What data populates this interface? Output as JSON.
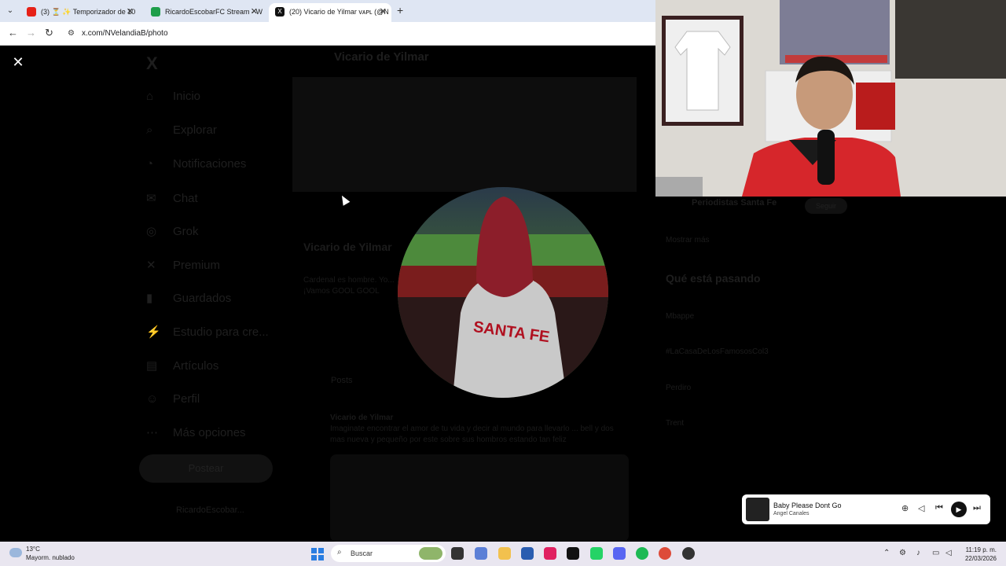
{
  "browser": {
    "tabs": [
      {
        "label": "(3) ⏳ ✨ Temporizador de 10",
        "favicon_color": "#e62117"
      },
      {
        "label": "RicardoEscobarFC Stream - Wa",
        "favicon_color": "#1e9e4a"
      },
      {
        "label": "(20) Vicario de Yilmar vᴀᴘʟ (@N",
        "favicon_color": "#111111"
      }
    ],
    "url": "x.com/NVelandiaB/photo"
  },
  "x_page": {
    "nav": [
      "Inicio",
      "Explorar",
      "Notificaciones",
      "Chat",
      "Grok",
      "Premium",
      "Guardados",
      "Estudio para cre...",
      "Artículos",
      "Perfil",
      "Más opciones"
    ],
    "post_button": "Postear",
    "account": "RicardoEscobar...",
    "header_name": "Vicario de Yilmar",
    "profile_name": "Vicario de Yilmar",
    "bio": "Cardenal es hombre. Yo... ¡Vamos GOOL GOOL",
    "tab_posts": "Posts",
    "post_author": "Vicario de Yilmar",
    "post_text": "Imaginate encontrar el amor de tu vida y decir al mundo para llevarlo ... bell y dos mas nueva y pequeño por este sobre sus hombros estando tan feliz"
  },
  "right_panel": {
    "follow_name": "Periodistas Santa Fe",
    "follow_button": "Seguir",
    "show_more": "Mostrar más",
    "trending_heading": "Qué está pasando",
    "trends": [
      "Mbappe",
      "#LaCasaDeLosFamososCol3",
      "Perdiro",
      "Trent"
    ]
  },
  "player": {
    "title": "Baby Please Dont Go",
    "artist": "Angel Canales"
  },
  "taskbar": {
    "temperature": "13°C",
    "condition": "Mayorm. nublado",
    "search": "Buscar",
    "time": "11:19 p. m.",
    "date": "22/03/2026"
  }
}
